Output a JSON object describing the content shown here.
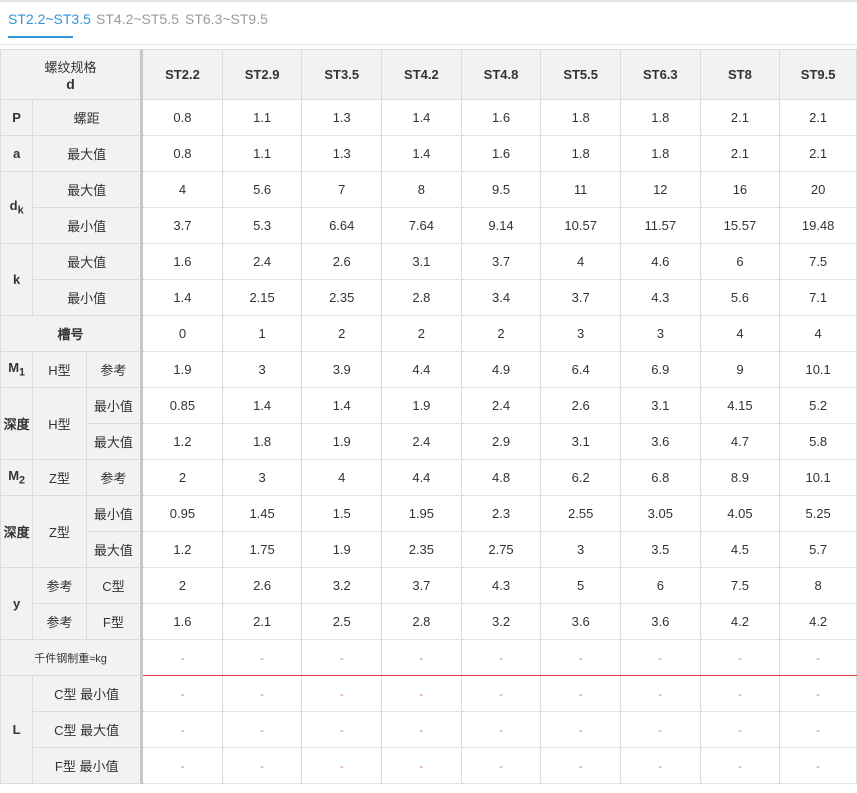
{
  "tabs": [
    {
      "label": "ST2.2~ST3.5"
    },
    {
      "label": "ST4.2~ST5.5"
    },
    {
      "label": "ST6.3~ST9.5"
    }
  ],
  "header": {
    "spec_label": "螺纹规格",
    "spec_symbol": "d",
    "columns": [
      "ST2.2",
      "ST2.9",
      "ST3.5",
      "ST4.2",
      "ST4.8",
      "ST5.5",
      "ST6.3",
      "ST8",
      "ST9.5"
    ]
  },
  "labels": {
    "P": "P",
    "pitch": "螺距",
    "a": "a",
    "max": "最大值",
    "min": "最小值",
    "dk_main": "d",
    "dk_sub": "k",
    "k": "k",
    "slot": "槽号",
    "M1_main": "M",
    "M1_sub": "1",
    "M2_main": "M",
    "M2_sub": "2",
    "H_type": "H型",
    "Z_type": "Z型",
    "ref": "参考",
    "depth": "深度",
    "y": "y",
    "C_type": "C型",
    "F_type": "F型",
    "weight": "千件钢制重≈kg",
    "L": "L",
    "L_c_min": "C型 最小值",
    "L_c_max": "C型 最大值",
    "L_f_min": "F型 最小值"
  },
  "rows": {
    "P": [
      "0.8",
      "1.1",
      "1.3",
      "1.4",
      "1.6",
      "1.8",
      "1.8",
      "2.1",
      "2.1"
    ],
    "a_max": [
      "0.8",
      "1.1",
      "1.3",
      "1.4",
      "1.6",
      "1.8",
      "1.8",
      "2.1",
      "2.1"
    ],
    "dk_max": [
      "4",
      "5.6",
      "7",
      "8",
      "9.5",
      "11",
      "12",
      "16",
      "20"
    ],
    "dk_min": [
      "3.7",
      "5.3",
      "6.64",
      "7.64",
      "9.14",
      "10.57",
      "11.57",
      "15.57",
      "19.48"
    ],
    "k_max": [
      "1.6",
      "2.4",
      "2.6",
      "3.1",
      "3.7",
      "4",
      "4.6",
      "6",
      "7.5"
    ],
    "k_min": [
      "1.4",
      "2.15",
      "2.35",
      "2.8",
      "3.4",
      "3.7",
      "4.3",
      "5.6",
      "7.1"
    ],
    "slot": [
      "0",
      "1",
      "2",
      "2",
      "2",
      "3",
      "3",
      "4",
      "4"
    ],
    "M1_ref": [
      "1.9",
      "3",
      "3.9",
      "4.4",
      "4.9",
      "6.4",
      "6.9",
      "9",
      "10.1"
    ],
    "depthH_min": [
      "0.85",
      "1.4",
      "1.4",
      "1.9",
      "2.4",
      "2.6",
      "3.1",
      "4.15",
      "5.2"
    ],
    "depthH_max": [
      "1.2",
      "1.8",
      "1.9",
      "2.4",
      "2.9",
      "3.1",
      "3.6",
      "4.7",
      "5.8"
    ],
    "M2_ref": [
      "2",
      "3",
      "4",
      "4.4",
      "4.8",
      "6.2",
      "6.8",
      "8.9",
      "10.1"
    ],
    "depthZ_min": [
      "0.95",
      "1.45",
      "1.5",
      "1.95",
      "2.3",
      "2.55",
      "3.05",
      "4.05",
      "5.25"
    ],
    "depthZ_max": [
      "1.2",
      "1.75",
      "1.9",
      "2.35",
      "2.75",
      "3",
      "3.5",
      "4.5",
      "5.7"
    ],
    "y_C": [
      "2",
      "2.6",
      "3.2",
      "3.7",
      "4.3",
      "5",
      "6",
      "7.5",
      "8"
    ],
    "y_F": [
      "1.6",
      "2.1",
      "2.5",
      "2.8",
      "3.2",
      "3.6",
      "3.6",
      "4.2",
      "4.2"
    ],
    "weight": [
      "-",
      "-",
      "-",
      "-",
      "-",
      "-",
      "-",
      "-",
      "-"
    ],
    "L_c_min": [
      "-",
      "-",
      "-",
      "-",
      "-",
      "-",
      "-",
      "-",
      "-"
    ],
    "L_c_max": [
      "-",
      "-",
      "-",
      "-",
      "-",
      "-",
      "-",
      "-",
      "-"
    ],
    "L_f_min": [
      "-",
      "-",
      "-",
      "-",
      "-",
      "-",
      "-",
      "-",
      "-"
    ]
  }
}
